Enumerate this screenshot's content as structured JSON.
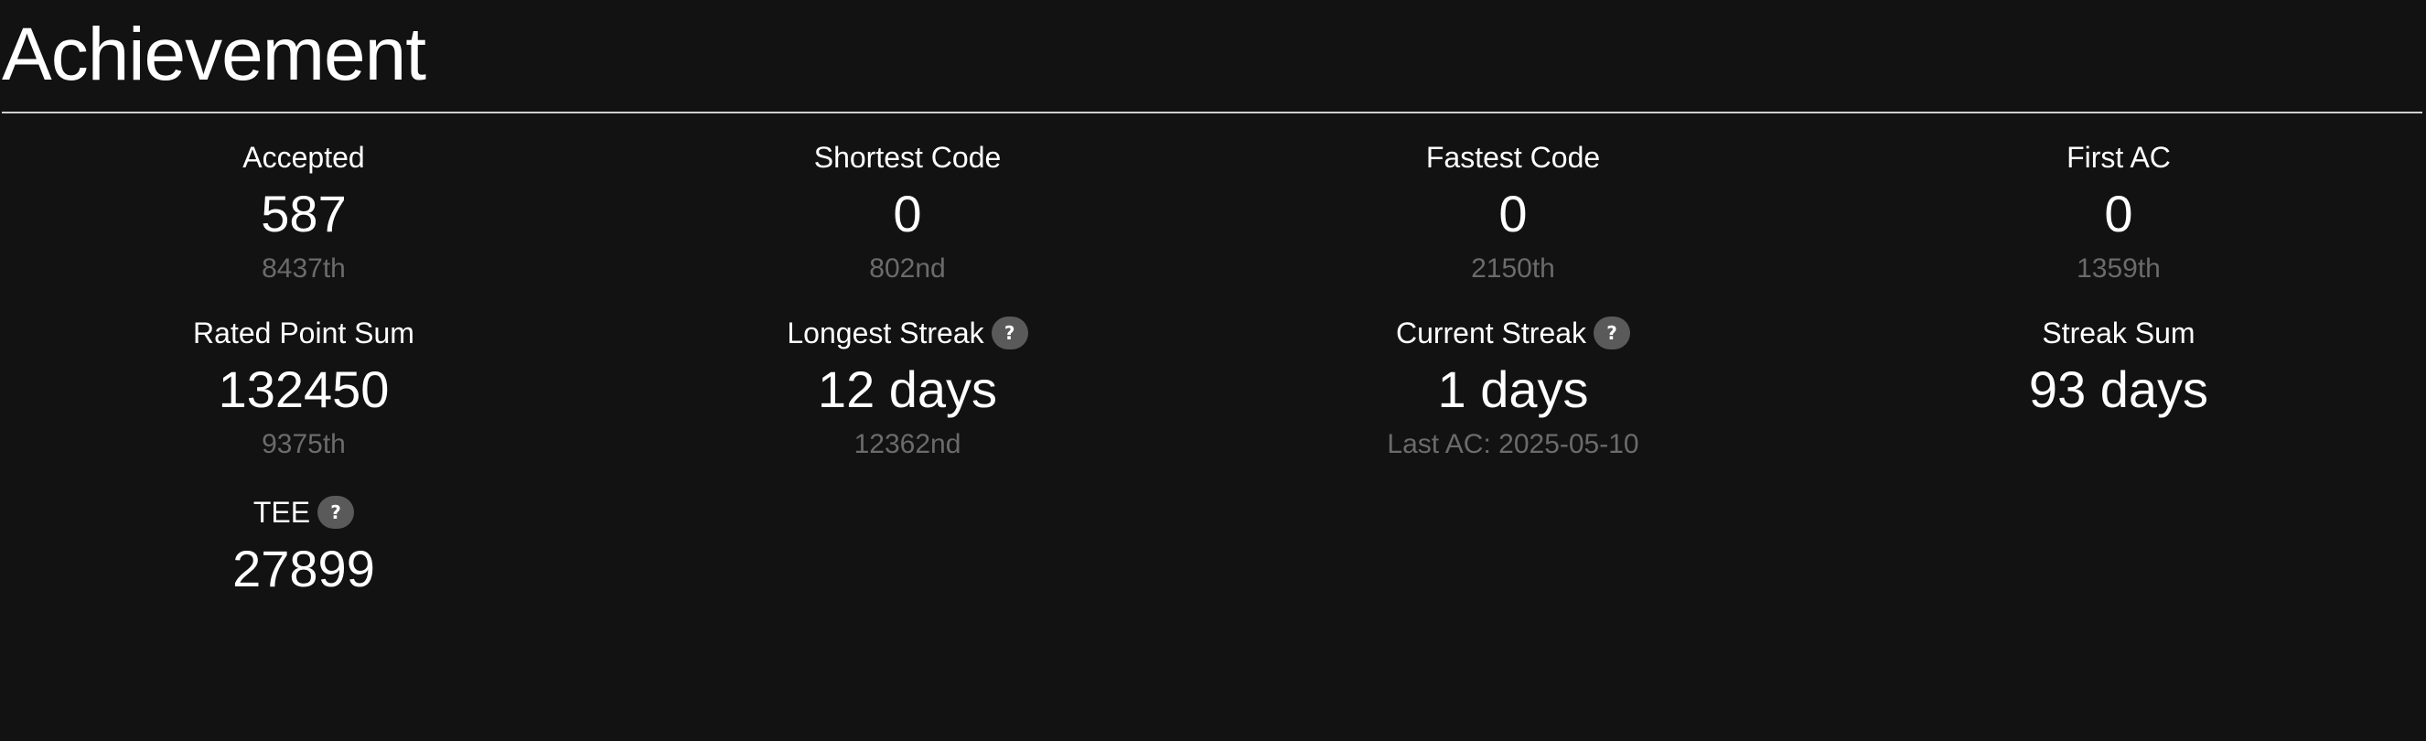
{
  "section_title": "Achievement",
  "columns": [
    {
      "cells": [
        {
          "label": "Accepted",
          "value": "587",
          "rank": "8437th",
          "help": false
        },
        {
          "label": "Rated Point Sum",
          "value": "132450",
          "rank": "9375th",
          "help": false
        },
        {
          "label": "TEE",
          "value": "27899",
          "rank": "",
          "help": true
        }
      ]
    },
    {
      "cells": [
        {
          "label": "Shortest Code",
          "value": "0",
          "rank": "802nd",
          "help": false
        },
        {
          "label": "Longest Streak",
          "value": "12 days",
          "rank": "12362nd",
          "help": true
        }
      ]
    },
    {
      "cells": [
        {
          "label": "Fastest Code",
          "value": "0",
          "rank": "2150th",
          "help": false
        },
        {
          "label": "Current Streak",
          "value": "1 days",
          "rank": "Last AC: 2025-05-10",
          "help": true
        }
      ]
    },
    {
      "cells": [
        {
          "label": "First AC",
          "value": "0",
          "rank": "1359th",
          "help": false
        },
        {
          "label": "Streak Sum",
          "value": "93 days",
          "rank": "",
          "help": false
        }
      ]
    }
  ],
  "help_icon_glyph": "?"
}
